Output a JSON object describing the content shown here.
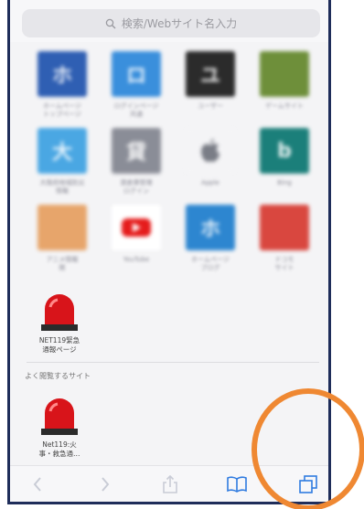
{
  "search": {
    "placeholder": "検索/Webサイト名入力"
  },
  "favorites": [
    {
      "letter": "ホ",
      "color": "#2f5fb3",
      "caption": "ホームページ\nトップページ"
    },
    {
      "letter": "ロ",
      "color": "#3a8fdc",
      "caption": "ログインページ\n共通"
    },
    {
      "letter": "ユ",
      "color": "#2b2b2b",
      "caption": "ユーザー"
    },
    {
      "letter": "",
      "color": "#6e8f3a",
      "caption": "ゲームサイト"
    },
    {
      "letter": "大",
      "color": "#4aa7e3",
      "caption": "大阪府地域防災\n情報"
    },
    {
      "letter": "貸",
      "color": "#8a8d97",
      "caption": "貸倉庫管理\nログイン"
    },
    {
      "letter": "",
      "color": "#f4f4f6",
      "caption": "Apple"
    },
    {
      "letter": "b",
      "color": "#1b7f7a",
      "caption": "Bing"
    },
    {
      "letter": "",
      "color": "#e7a56b",
      "caption": "アニメ情報\n館"
    },
    {
      "letter": "",
      "color": "#ffffff",
      "caption": "YouTube"
    },
    {
      "letter": "ホ",
      "color": "#2d86d0",
      "caption": "ホームページ\nブログ"
    },
    {
      "letter": "",
      "color": "#d9473f",
      "caption": "ドコモ\nサイト"
    }
  ],
  "net119_favorite": {
    "caption": "NET119緊急\n通報ページ"
  },
  "frequent": {
    "title": "よく閲覧するサイト",
    "item": {
      "caption": "Net119:火\n事・救急通…"
    }
  },
  "toolbar": {
    "back_icon": "chevron-left-icon",
    "forward_icon": "chevron-right-icon",
    "share_icon": "share-icon",
    "bookmarks_icon": "book-icon",
    "tabs_icon": "tabs-icon"
  },
  "colors": {
    "highlight_ring": "#ef8832",
    "frame": "#1f2d5a",
    "siren_red": "#d8141a"
  }
}
